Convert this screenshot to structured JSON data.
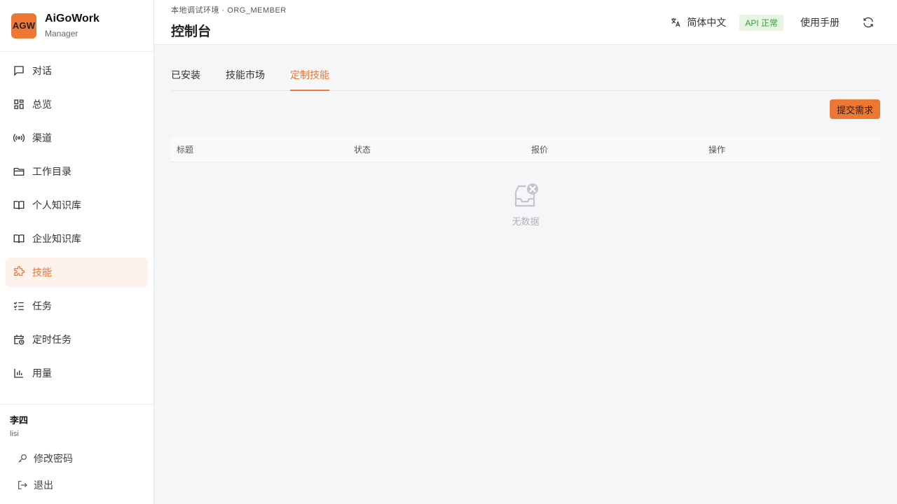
{
  "brand": {
    "logo": "AGW",
    "name": "AiGoWork",
    "sub": "Manager"
  },
  "nav": [
    {
      "label": "对话",
      "icon": "chat-icon"
    },
    {
      "label": "总览",
      "icon": "dashboard-icon"
    },
    {
      "label": "渠道",
      "icon": "broadcast-icon"
    },
    {
      "label": "工作目录",
      "icon": "folder-icon"
    },
    {
      "label": "个人知识库",
      "icon": "book-icon"
    },
    {
      "label": "企业知识库",
      "icon": "book-icon"
    },
    {
      "label": "技能",
      "icon": "puzzle-icon",
      "active": true
    },
    {
      "label": "任务",
      "icon": "checklist-icon"
    },
    {
      "label": "定时任务",
      "icon": "calendar-clock-icon"
    },
    {
      "label": "用量",
      "icon": "bar-chart-icon"
    }
  ],
  "user": {
    "name": "李四",
    "id": "lisi",
    "change_password": "修改密码",
    "logout": "退出"
  },
  "header": {
    "env": "本地调试环境 · ORG_MEMBER",
    "title": "控制台",
    "language": "简体中文",
    "api_status": "API 正常",
    "manual": "使用手册"
  },
  "tabs": [
    {
      "label": "已安装"
    },
    {
      "label": "技能市场"
    },
    {
      "label": "定制技能",
      "active": true
    }
  ],
  "toolbar": {
    "submit_label": "提交需求"
  },
  "table": {
    "columns": [
      "标题",
      "状态",
      "报价",
      "操作"
    ],
    "empty_text": "无数据"
  },
  "colors": {
    "accent": "#ee7733",
    "api_ok_bg": "#e8f5e4",
    "api_ok_text": "#3a9a3a"
  }
}
